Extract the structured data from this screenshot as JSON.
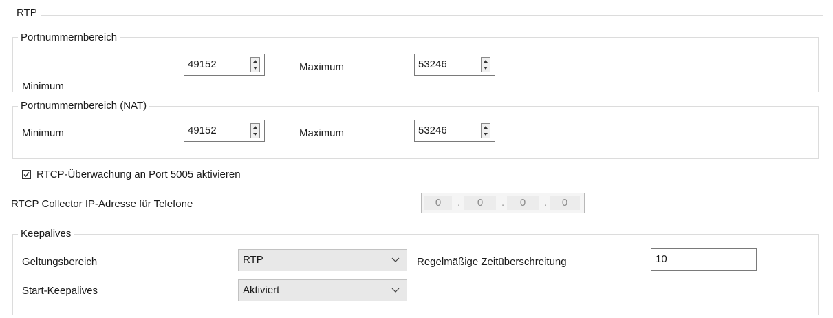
{
  "rtp": {
    "title": "RTP",
    "port_range": {
      "legend": "Portnummernbereich",
      "min_label": "Minimum",
      "min_value": "49152",
      "max_label": "Maximum",
      "max_value": "53246"
    },
    "port_range_nat": {
      "legend": "Portnummernbereich (NAT)",
      "min_label": "Minimum",
      "min_value": "49152",
      "max_label": "Maximum",
      "max_value": "53246"
    },
    "rtcp_checkbox": {
      "label": "RTCP-Überwachung an Port 5005 aktivieren",
      "checked": true
    },
    "collector": {
      "label": "RTCP Collector IP-Adresse für Telefone",
      "octets": [
        "0",
        "0",
        "0",
        "0"
      ]
    },
    "keepalives": {
      "legend": "Keepalives",
      "scope_label": "Geltungsbereich",
      "scope_value": "RTP",
      "timeout_label": "Regelmäßige Zeitüberschreitung",
      "timeout_value": "10",
      "start_label": "Start-Keepalives",
      "start_value": "Aktiviert"
    }
  }
}
